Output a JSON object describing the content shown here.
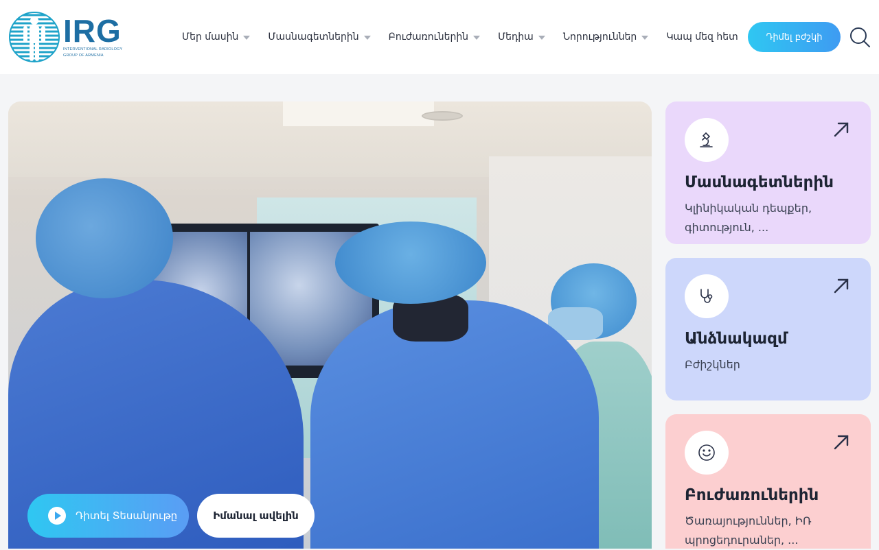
{
  "brand": {
    "logo_text": "IRG",
    "logo_subtext_line1": "INTERVENTIONAL RADIOLOGY",
    "logo_subtext_line2": "GROUP OF ARMENIA",
    "color_primary": "#1d6ea3"
  },
  "nav": {
    "items": [
      {
        "label": "Մեր մասին",
        "has_dropdown": true
      },
      {
        "label": "Մասնագետներին",
        "has_dropdown": true
      },
      {
        "label": "Բուժառուներին",
        "has_dropdown": true
      },
      {
        "label": "Մեդիա",
        "has_dropdown": true
      },
      {
        "label": "Նորություններ",
        "has_dropdown": true
      },
      {
        "label": "Կապ մեզ հետ",
        "has_dropdown": false
      }
    ],
    "cta_label": "Դիմել բժշկի",
    "search_icon": "search-icon"
  },
  "hero": {
    "video_button_label": "Դիտել Տեսանյութը",
    "more_button_label": "Իմանալ ավելին"
  },
  "cards": [
    {
      "title": "Մասնագետներին",
      "desc": "Կլինիկական դեպքեր, գիտություն, ...",
      "icon": "microscope-icon",
      "color": "#ead8fb"
    },
    {
      "title": "Անձնակազմ",
      "desc": "Բժիշկներ",
      "icon": "stethoscope-icon",
      "color": "#cdd7fb"
    },
    {
      "title": "Բուժառուներին",
      "desc": "Ծառայություններ, ԻՌ պրոցեդուրաներ, ...",
      "icon": "smile-icon",
      "color": "#fccfd0"
    }
  ]
}
